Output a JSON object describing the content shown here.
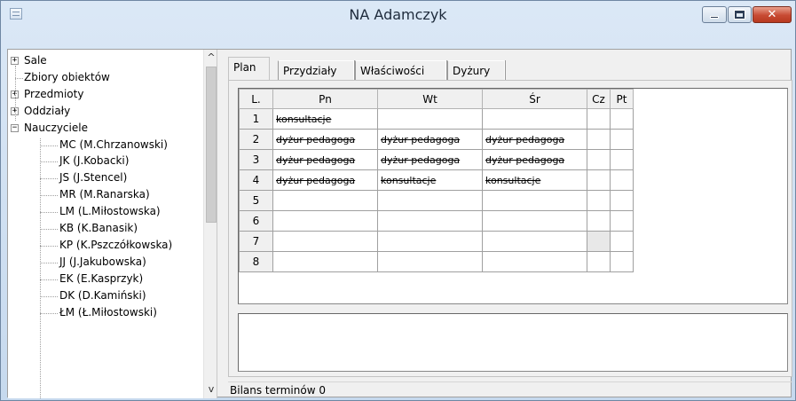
{
  "window": {
    "title": "NA Adamczyk",
    "close_glyph": "✕"
  },
  "tree": {
    "items": [
      {
        "label": "Sale",
        "expander": "+"
      },
      {
        "label": "Zbiory obiektów",
        "expander": ""
      },
      {
        "label": "Przedmioty",
        "expander": "+"
      },
      {
        "label": "Oddziały",
        "expander": "+"
      },
      {
        "label": "Nauczyciele",
        "expander": "−"
      },
      {
        "label": "MC (M.Chrzanowski)"
      },
      {
        "label": "JK (J.Kobacki)"
      },
      {
        "label": "JS (J.Stencel)"
      },
      {
        "label": "MR (M.Ranarska)"
      },
      {
        "label": "LM (L.Miłostowska)"
      },
      {
        "label": "KB (K.Banasik)"
      },
      {
        "label": "KP (K.Pszczółkowska)"
      },
      {
        "label": "JJ (J.Jakubowska)"
      },
      {
        "label": "EK (E.Kasprzyk)"
      },
      {
        "label": "DK (D.Kamiński)"
      },
      {
        "label": "ŁM (Ł.Miłostowski)"
      }
    ],
    "scroll_up": "^",
    "scroll_down": "v"
  },
  "tabs": [
    "Plan",
    "Przydziały",
    "Właściwości",
    "Dyżury"
  ],
  "plan": {
    "headers": [
      "L.",
      "Pn",
      "Wt",
      "Śr",
      "Cz",
      "Pt"
    ],
    "rows": [
      {
        "n": "1",
        "cells": [
          "konsultacje",
          "",
          "",
          "",
          ""
        ]
      },
      {
        "n": "2",
        "cells": [
          "dyżur pedagoga",
          "dyżur pedagoga",
          "dyżur pedagoga",
          "",
          ""
        ]
      },
      {
        "n": "3",
        "cells": [
          "dyżur pedagoga",
          "dyżur pedagoga",
          "dyżur pedagoga",
          "",
          ""
        ]
      },
      {
        "n": "4",
        "cells": [
          "dyżur pedagoga",
          "konsultacje",
          "konsultacje",
          "",
          ""
        ]
      },
      {
        "n": "5",
        "cells": [
          "",
          "",
          "",
          "",
          ""
        ]
      },
      {
        "n": "6",
        "cells": [
          "",
          "",
          "",
          "",
          ""
        ]
      },
      {
        "n": "7",
        "cells": [
          "",
          "",
          "",
          "",
          ""
        ]
      },
      {
        "n": "8",
        "cells": [
          "",
          "",
          "",
          "",
          ""
        ]
      }
    ]
  },
  "status": {
    "text": "Bilans terminów 0"
  }
}
